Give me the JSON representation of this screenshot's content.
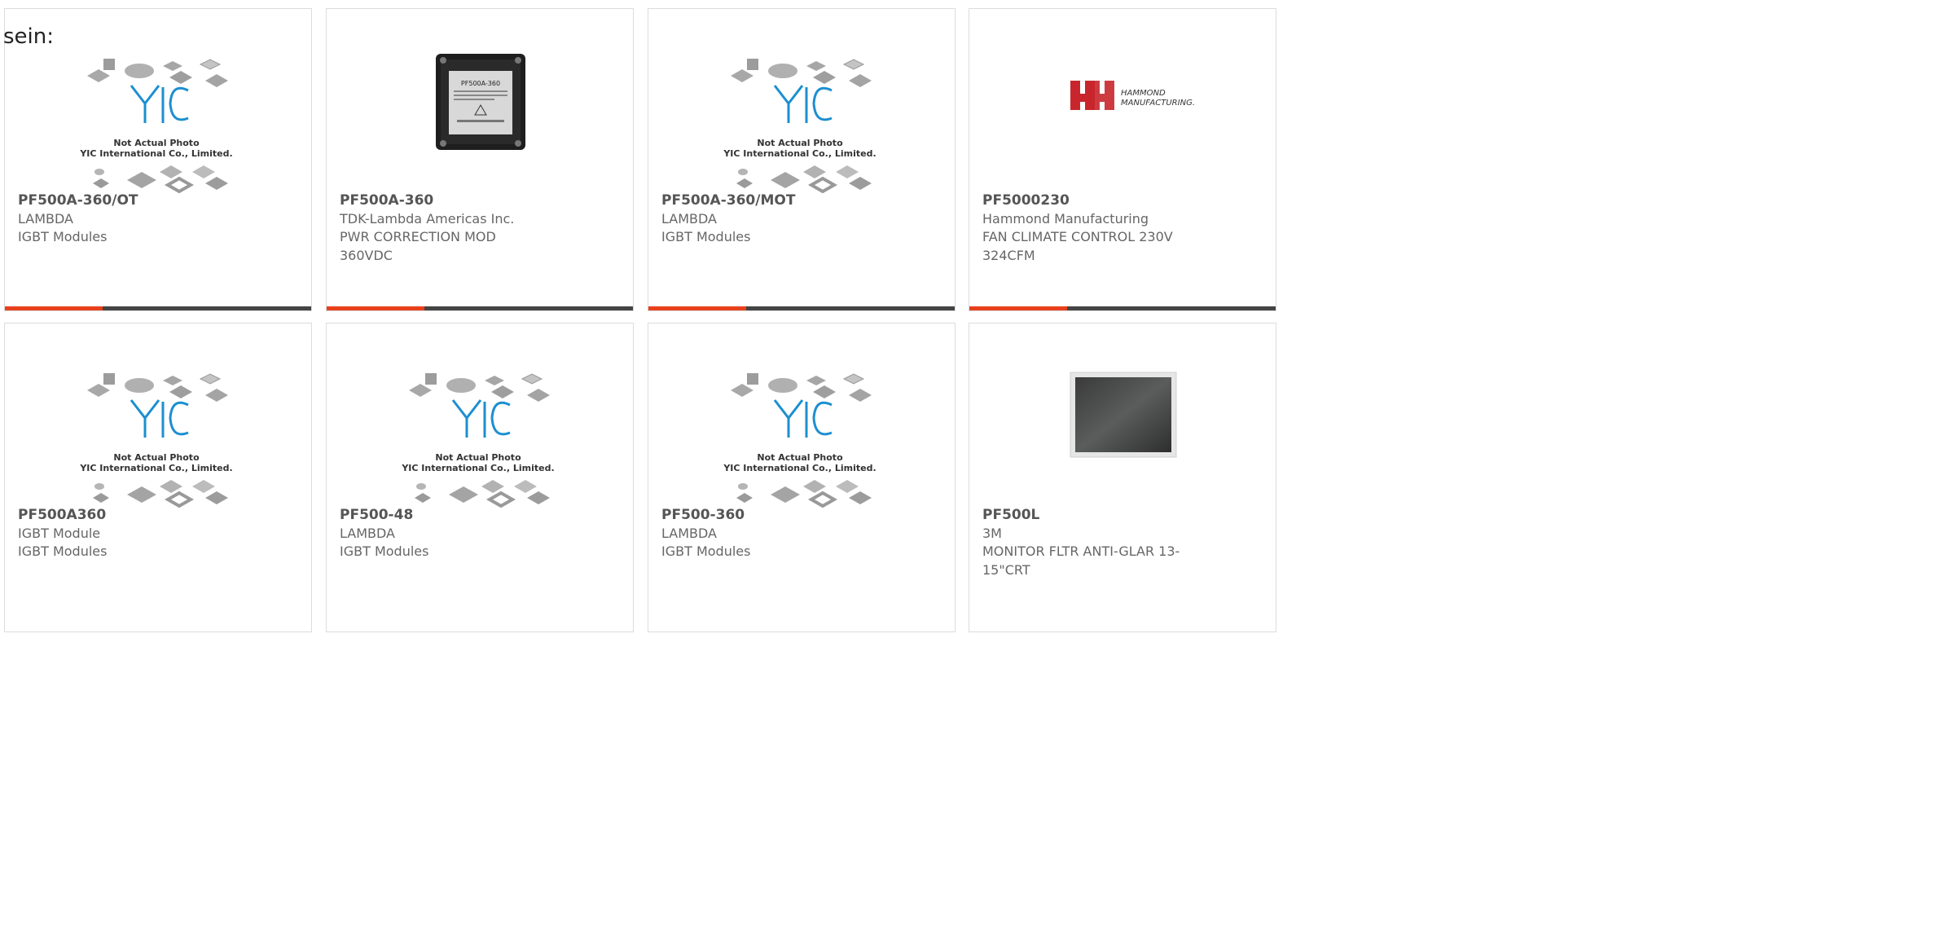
{
  "intro_text": "sein:",
  "colors": {
    "accent": "#e8401c",
    "bar": "#444444",
    "text": "#666666",
    "hammond_red": "#c8262c"
  },
  "placeholder": {
    "logo_text": "YIC",
    "line1": "Not Actual Photo",
    "line2": "YIC International Co., Limited."
  },
  "module_label": "PF500A-360",
  "hammond_logo": {
    "line1": "HAMMOND",
    "line2": "MANUFACTURING."
  },
  "products": [
    {
      "part": "PF500A-360/OT",
      "maker": "LAMBDA",
      "desc": "IGBT Modules",
      "image": "placeholder"
    },
    {
      "part": "PF500A-360",
      "maker": "TDK-Lambda Americas Inc.",
      "desc": "PWR CORRECTION MOD 360VDC",
      "image": "module"
    },
    {
      "part": "PF500A-360/MOT",
      "maker": "LAMBDA",
      "desc": "IGBT Modules",
      "image": "placeholder"
    },
    {
      "part": "PF5000230",
      "maker": "Hammond Manufacturing",
      "desc": "FAN CLIMATE CONTROL 230V 324CFM",
      "image": "hammond-logo"
    },
    {
      "part": "PF500A360",
      "maker": "IGBT Module",
      "desc": "IGBT Modules",
      "image": "placeholder"
    },
    {
      "part": "PF500-48",
      "maker": "LAMBDA",
      "desc": "IGBT Modules",
      "image": "placeholder"
    },
    {
      "part": "PF500-360",
      "maker": "LAMBDA",
      "desc": "IGBT Modules",
      "image": "placeholder"
    },
    {
      "part": "PF500L",
      "maker": "3M",
      "desc": "MONITOR FLTR ANTI-GLAR 13-15\"CRT",
      "image": "monitor-filter"
    }
  ]
}
